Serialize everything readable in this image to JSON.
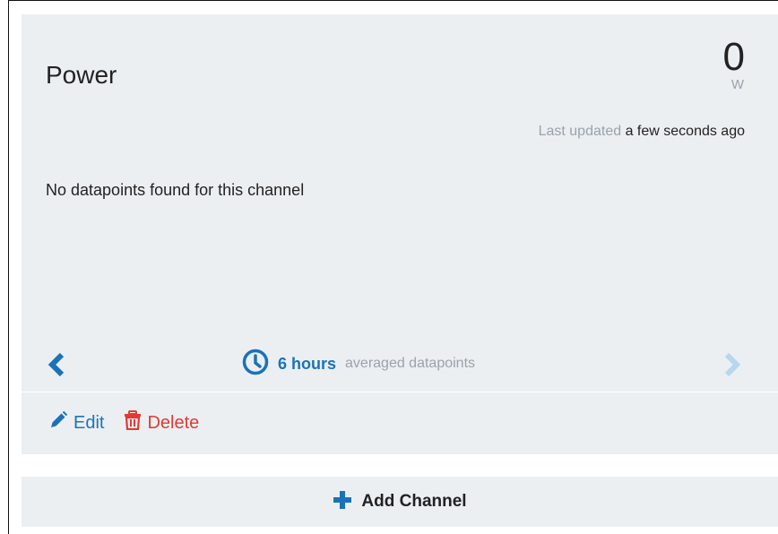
{
  "channel": {
    "title": "Power",
    "value": "0",
    "unit": "W",
    "last_updated_label": "Last updated",
    "last_updated_value": "a few seconds ago",
    "empty_message": "No datapoints found for this channel",
    "range_value": "6 hours",
    "range_description": "averaged datapoints"
  },
  "actions": {
    "edit_label": "Edit",
    "delete_label": "Delete"
  },
  "footer": {
    "add_channel_label": "Add Channel"
  },
  "colors": {
    "accent_blue": "#1a73b8",
    "danger_red": "#e03b35",
    "muted_gray": "#9aa3ab",
    "card_bg": "#eceff2"
  },
  "icons": {
    "prev": "chevron-left-icon",
    "next": "chevron-right-icon",
    "range": "clock-icon",
    "edit": "pencil-icon",
    "delete": "trash-icon",
    "add": "plus-icon"
  }
}
